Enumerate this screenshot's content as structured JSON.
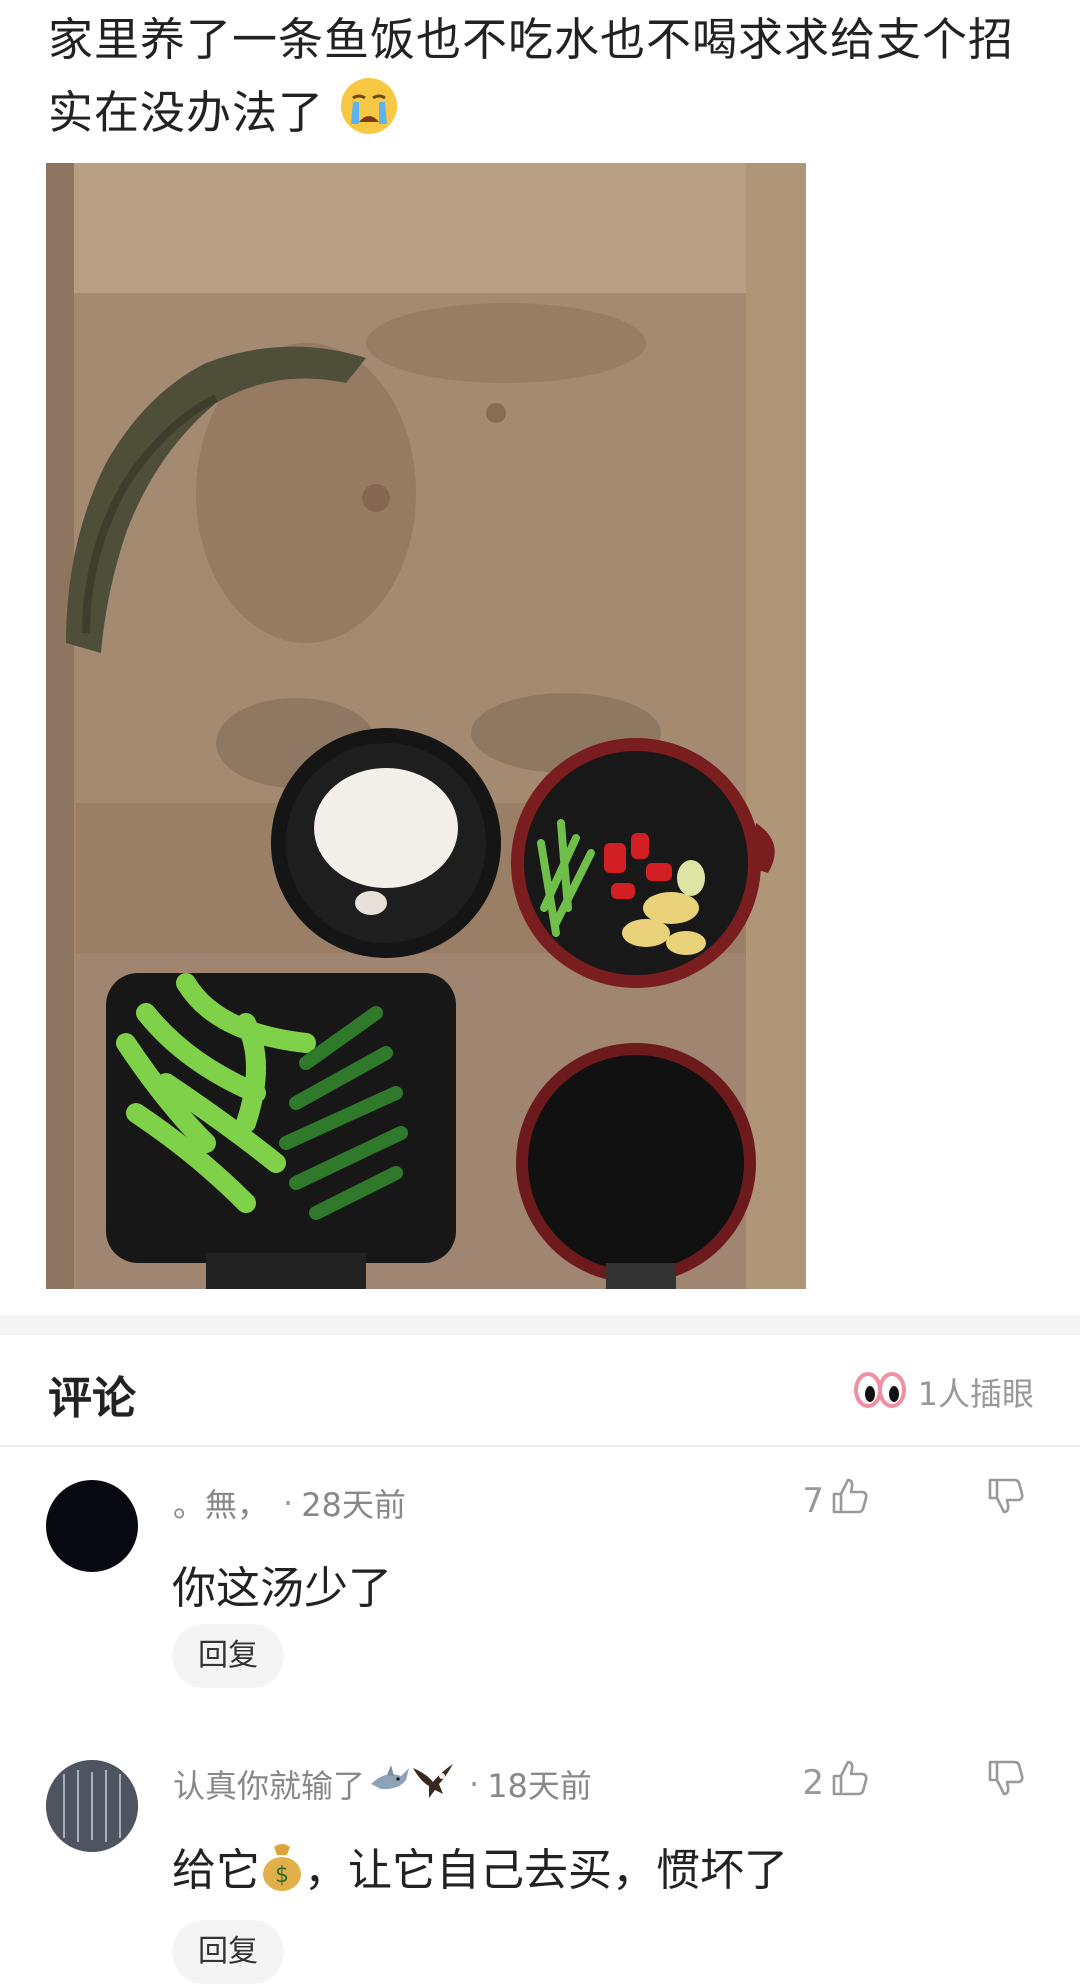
{
  "post": {
    "title": "家里养了一条鱼饭也不吃水也不喝求求给支个招实在没办法了"
  },
  "comments_section": {
    "title": "评论",
    "reaction_count": "1人插眼"
  },
  "comments": [
    {
      "username": "。無，",
      "time": "28天前",
      "content": "你这汤少了",
      "likes": "7",
      "reply_label": "回复"
    },
    {
      "username": "认真你就输了",
      "time": "18天前",
      "content_before": "给它",
      "content_after": "，让它自己去买，惯坏了",
      "likes": "2",
      "reply_label": "回复"
    }
  ],
  "icons": {
    "crying_emoji": "crying-face-emoji",
    "money_emoji": "money-bag-emoji",
    "eyes": "eyes-icon",
    "like": "thumbs-up-icon",
    "dislike": "thumbs-down-icon",
    "shark": "shark-emoji",
    "eagle": "eagle-emoji"
  },
  "colors": {
    "text": "#222222",
    "meta": "#888888",
    "divider": "#f5f5f5",
    "reply_bg": "#f4f4f4"
  }
}
